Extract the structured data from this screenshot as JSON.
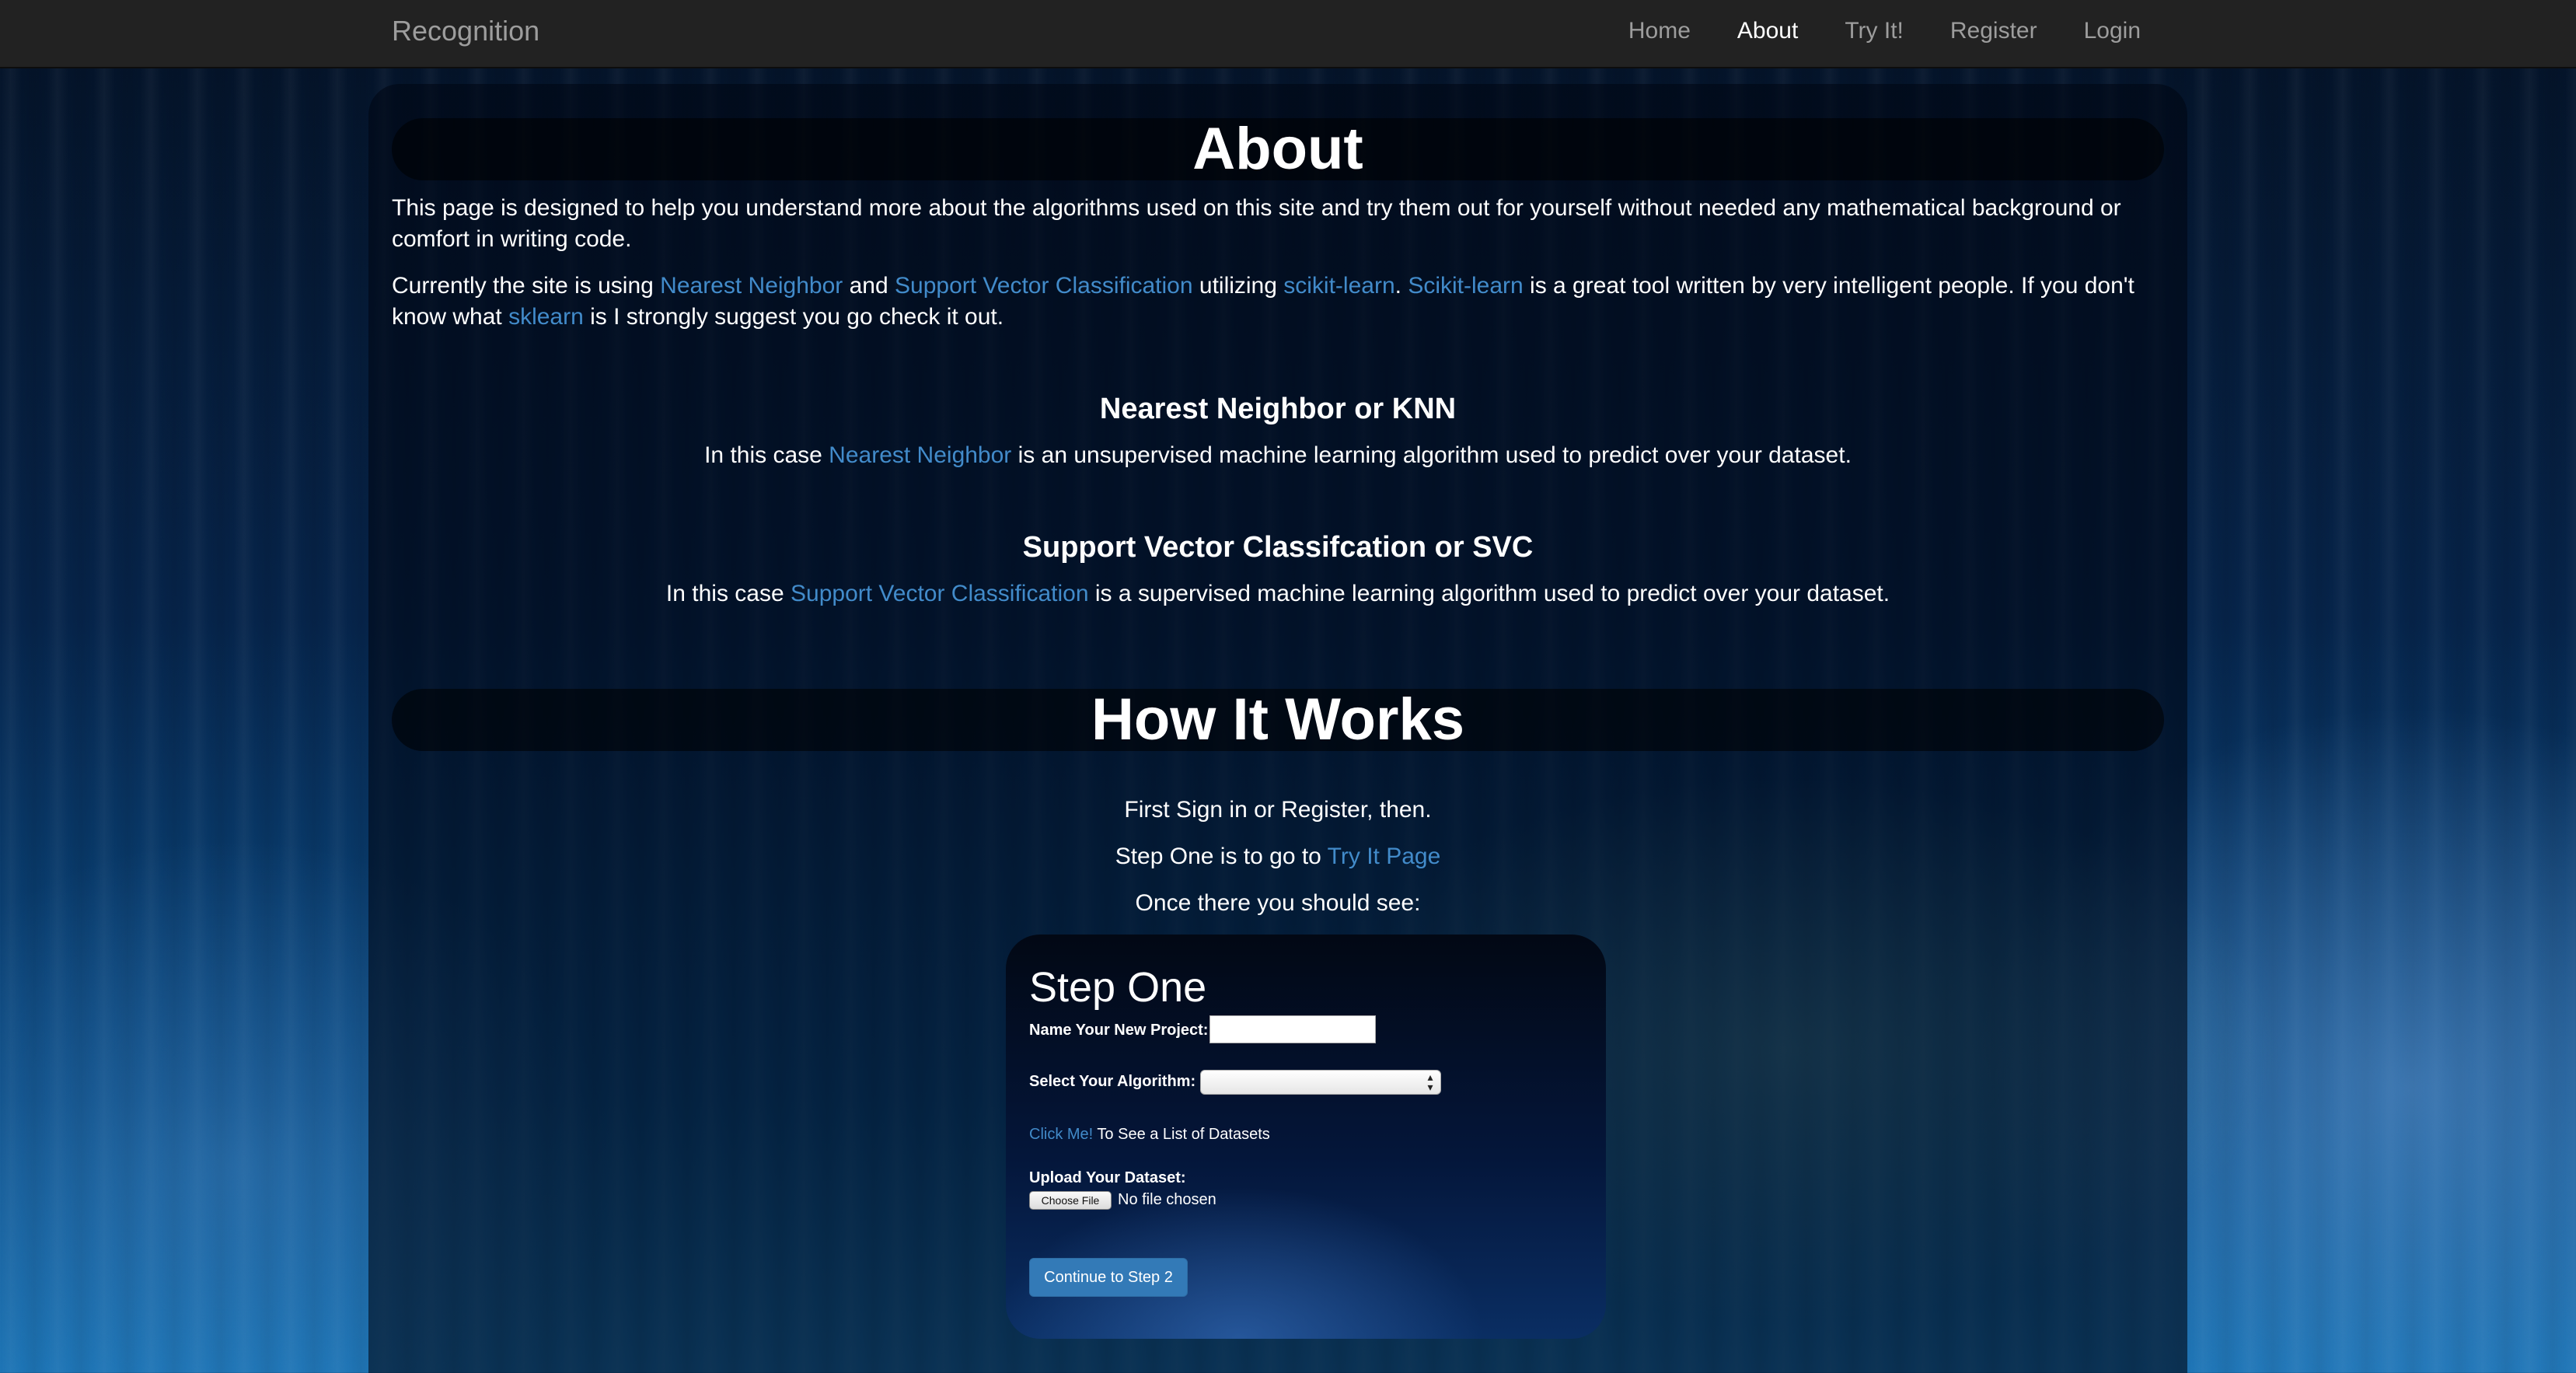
{
  "navbar": {
    "brand": "Recognition",
    "items": [
      {
        "label": "Home",
        "active": false
      },
      {
        "label": "About",
        "active": true
      },
      {
        "label": "Try It!",
        "active": false
      },
      {
        "label": "Register",
        "active": false
      },
      {
        "label": "Login",
        "active": false
      }
    ]
  },
  "about": {
    "title": "About",
    "intro": "This page is designed to help you understand more about the algorithms used on this site and try them out for yourself without needed any mathematical background or comfort in writing code.",
    "current": {
      "t1": "Currently the site is using ",
      "l1": "Nearest Neighbor",
      "t2": " and ",
      "l2": "Support Vector Classification",
      "t3": " utilizing ",
      "l3": "scikit-learn",
      "t4": ". ",
      "l4": "Scikit-learn",
      "t5": " is a great tool written by very intelligent people. If you don't know what ",
      "l5": "sklearn",
      "t6": " is I strongly suggest you go check it out."
    }
  },
  "knn": {
    "title": "Nearest Neighbor or KNN",
    "t1": "In this case ",
    "link": "Nearest Neighbor",
    "t2": " is an unsupervised machine learning algorithm used to predict over your dataset."
  },
  "svc": {
    "title": "Support Vector Classifcation or SVC",
    "t1": "In this case ",
    "link": "Support Vector Classification",
    "t2": " is a supervised machine learning algorithm used to predict over your dataset."
  },
  "how": {
    "title": "How It Works",
    "line1": "First Sign in or Register, then.",
    "line2_text": "Step One is to go to ",
    "line2_link": "Try It Page",
    "line3": "Once there you should see:"
  },
  "step_one": {
    "title": "Step One",
    "name_label": "Name Your New Project:",
    "name_value": "",
    "algorithm_label": "Select Your Algorithm:",
    "algorithm_value": "",
    "datasets_link": "Click Me!",
    "datasets_text": " To See a List of Datasets",
    "upload_label": "Upload Your Dataset:",
    "file_button": "Choose File",
    "file_status": "No file chosen",
    "continue_button": "Continue to Step 2"
  }
}
